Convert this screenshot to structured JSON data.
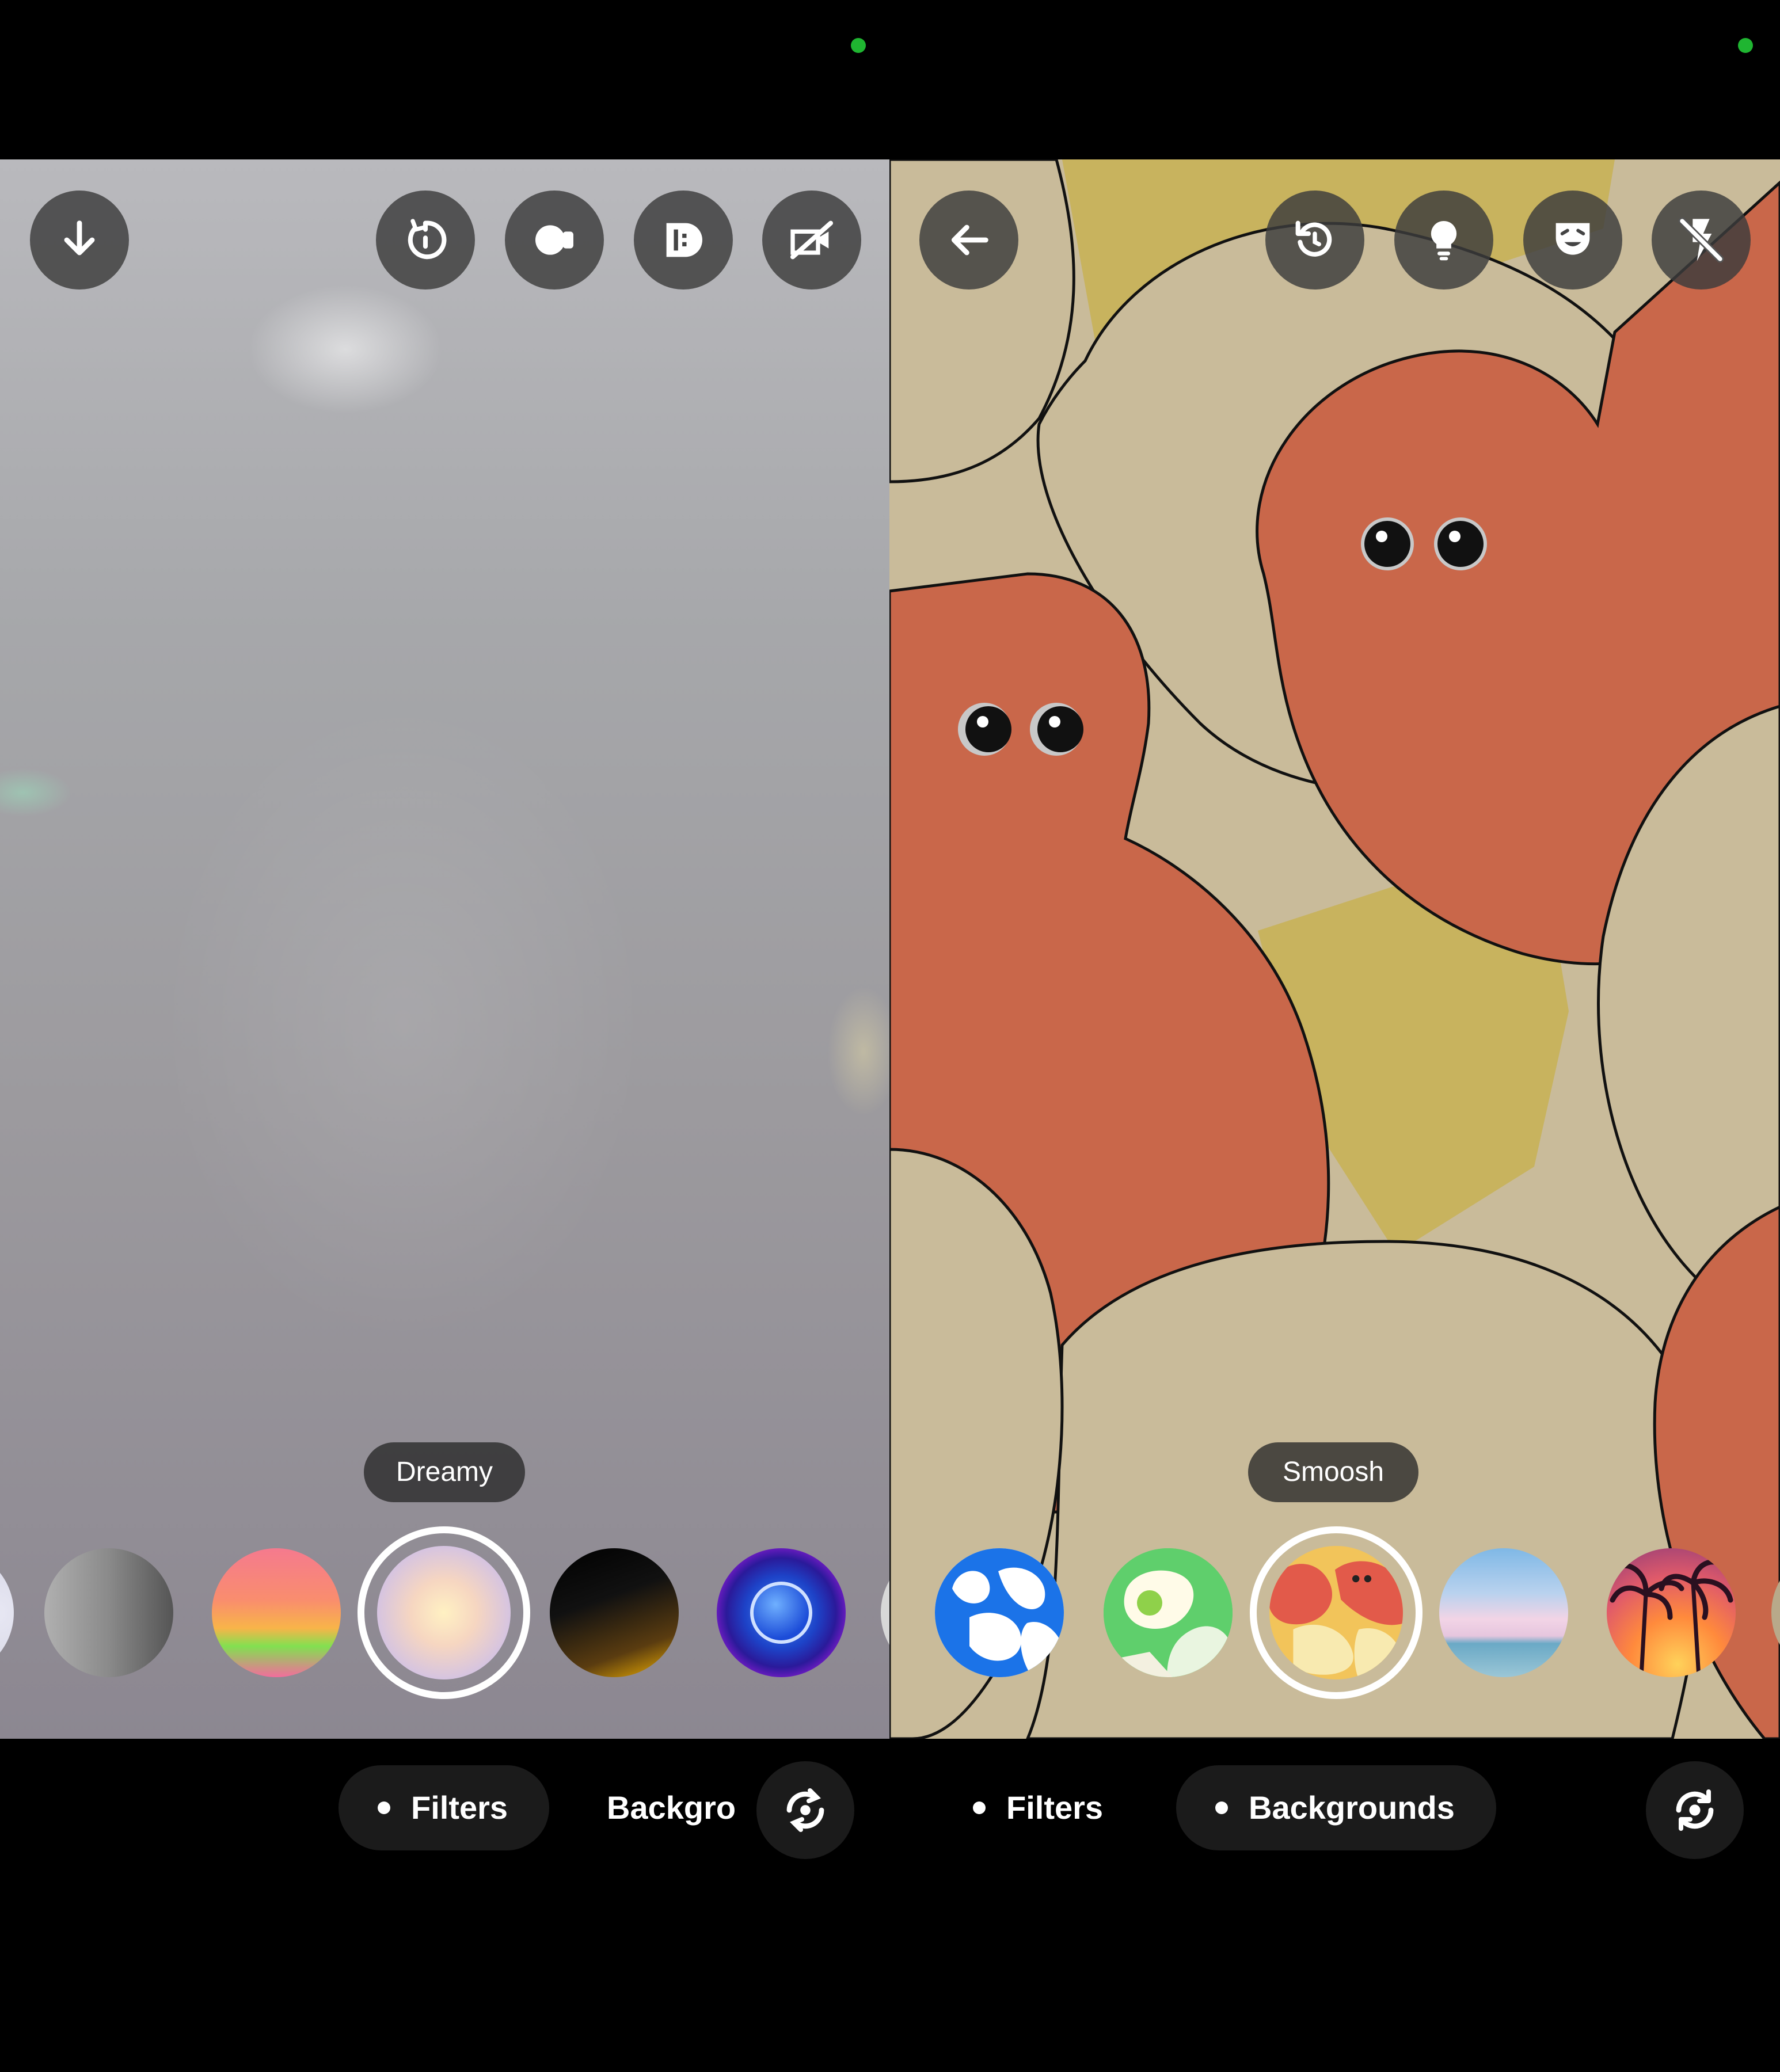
{
  "left_panel": {
    "filter_label": "Dreamy",
    "tabs": {
      "filters": "Filters",
      "backgrounds": "Backgro"
    },
    "top_buttons": [
      "download-icon",
      "timer-icon",
      "spotlight-icon",
      "hdr-icon",
      "flash-off-icon"
    ],
    "thumbnails": [
      "partial-white",
      "gray",
      "rainbow",
      "dreamy",
      "dark-gold",
      "blue-orb",
      "partial-edge"
    ],
    "selected_filter": "Dreamy"
  },
  "right_panel": {
    "filter_label": "Smoosh",
    "tabs": {
      "filters": "Filters",
      "backgrounds": "Backgrounds"
    },
    "top_buttons": [
      "back-arrow-icon",
      "rotate-icon",
      "lightbulb-icon",
      "mask-icon",
      "flash-off-icon"
    ],
    "thumbnails": [
      "blue-blobs",
      "fried-egg",
      "smoosh",
      "sunset-sky",
      "palm-trees",
      "partial-edge"
    ],
    "selected_background": "Smoosh"
  },
  "colors": {
    "status_dot": "#1fb531",
    "accent_ring": "#ffffff",
    "smoosh_orange": "#c9674a",
    "smoosh_beige": "#c9bb9a",
    "smoosh_mustard": "#c8b35e"
  }
}
